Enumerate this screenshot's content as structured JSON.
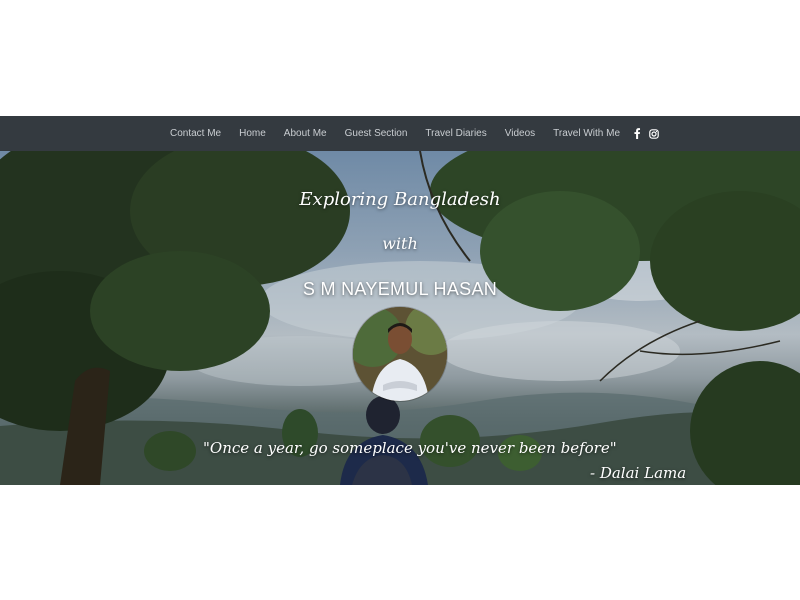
{
  "nav": {
    "items": [
      {
        "label": "Contact Me"
      },
      {
        "label": "Home"
      },
      {
        "label": "About Me"
      },
      {
        "label": "Guest Section"
      },
      {
        "label": "Travel Diaries"
      },
      {
        "label": "Videos"
      },
      {
        "label": "Travel With Me"
      }
    ],
    "social_icons": [
      "facebook-icon",
      "instagram-icon"
    ],
    "background_color": "#343a40",
    "text_color": "#c9cdd1"
  },
  "hero": {
    "title_line1": "Exploring Bangladesh",
    "title_line2": "with",
    "name": "S M NAYEMUL HASAN",
    "quote": "\"Once a year, go someplace you've never been before\"",
    "quote_author": "- Dalai Lama"
  }
}
